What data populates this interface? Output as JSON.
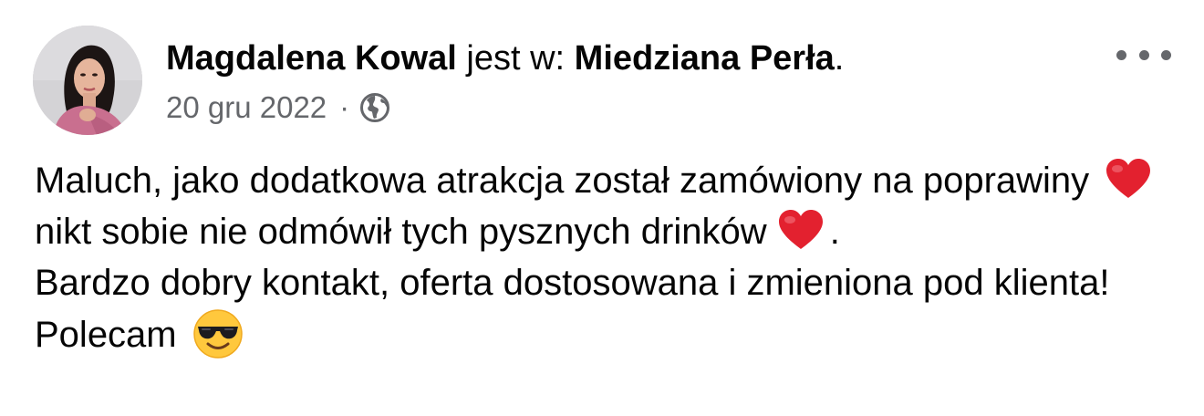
{
  "post": {
    "author": "Magdalena Kowal",
    "connector": "jest w:",
    "place": "Miedziana Perła",
    "place_suffix": ".",
    "date": "20 gru 2022",
    "separator": "·",
    "privacy_icon": "globe-icon",
    "more_icon": "more-options-icon",
    "body": {
      "line1": "Maluch, jako dodatkowa atrakcja został zamówiony na poprawiny",
      "line1_emoji": "heart-emoji",
      "line2": "nikt sobie nie odmówił tych pysznych drinków",
      "line2_emoji": "heart-emoji",
      "line2_end": ".",
      "line3": "Bardzo dobry kontakt, oferta dostosowana i zmieniona pod klienta! Polecam",
      "line3_emoji": "smiling-face-with-sunglasses-emoji"
    }
  },
  "colors": {
    "text": "#050505",
    "secondary": "#65676b",
    "heart": "#e3212f",
    "emoji_face": "#ffc83d"
  }
}
